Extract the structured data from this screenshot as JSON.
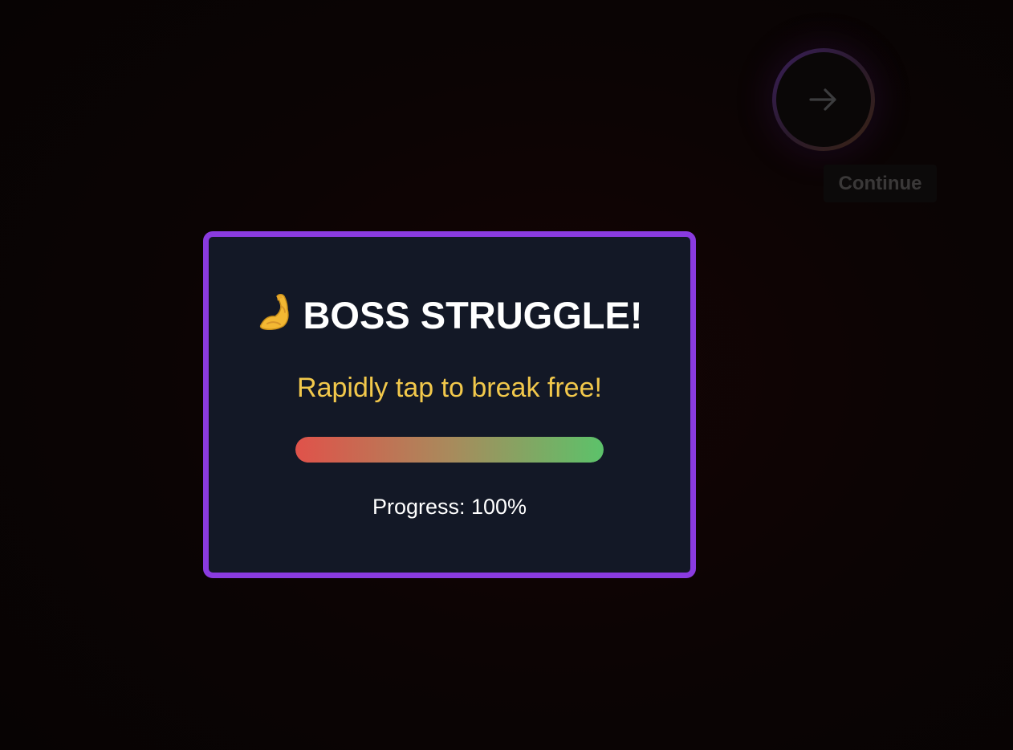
{
  "nav": {
    "next_icon": "arrow-right-icon",
    "continue_label": "Continue"
  },
  "modal": {
    "title_icon": "flexed-biceps-icon",
    "title": "BOSS STRUGGLE!",
    "subtitle": "Rapidly tap to break free!",
    "progress_fraction": 1.0,
    "progress_text": "Progress: 100%"
  },
  "colors": {
    "modal_border": "#8a3be0",
    "modal_bg": "#131826",
    "subtitle": "#f2c84b",
    "progress_start": "#e0524a",
    "progress_end": "#5cc26a"
  }
}
